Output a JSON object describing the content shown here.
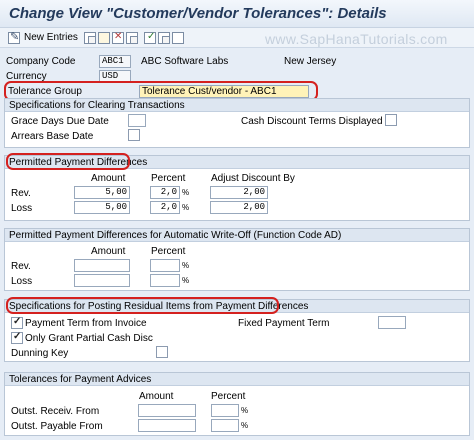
{
  "window": {
    "title": "Change View \"Customer/Vendor Tolerances\": Details"
  },
  "toolbar": {
    "new_entries": "New Entries",
    "icons": [
      "pen-icon",
      "save-icon",
      "copy-icon",
      "delete-icon",
      "select-all-icon",
      "deselect-icon",
      "copy-as-icon"
    ]
  },
  "watermark": "www.SapHanaTutorials.com",
  "header": {
    "company_code_label": "Company Code",
    "company_code_value": "ABC1",
    "company_name": "ABC Software Labs",
    "city": "New Jersey",
    "currency_label": "Currency",
    "currency_value": "USD",
    "tolerance_group_label": "Tolerance Group",
    "tolerance_group_value": "Tolerance Cust/vendor - ABC1"
  },
  "clearing": {
    "title": "Specifications for Clearing Transactions",
    "grace_days_label": "Grace Days Due Date",
    "grace_days_value": "",
    "cash_discount_label": "Cash Discount Terms Displayed",
    "arrears_label": "Arrears Base Date"
  },
  "permitted": {
    "title": "Permitted Payment Differences",
    "col_amount": "Amount",
    "col_percent": "Percent",
    "col_adjust": "Adjust Discount By",
    "rows": [
      {
        "label": "Rev.",
        "amount": "5,00",
        "percent": "2,0",
        "unit": "%",
        "adjust": "2,00"
      },
      {
        "label": "Loss",
        "amount": "5,00",
        "percent": "2,0",
        "unit": "%",
        "adjust": "2,00"
      }
    ]
  },
  "writeoff": {
    "title": "Permitted Payment Differences for Automatic Write-Off (Function Code AD)",
    "col_amount": "Amount",
    "col_percent": "Percent",
    "rows": [
      {
        "label": "Rev.",
        "amount": "",
        "percent": "",
        "unit": "%"
      },
      {
        "label": "Loss",
        "amount": "",
        "percent": "",
        "unit": "%"
      }
    ]
  },
  "residual": {
    "title": "Specifications for Posting Residual Items from Payment Differences",
    "payment_term_label": "Payment Term from Invoice",
    "payment_term_checked": true,
    "only_partial_label": "Only Grant Partial Cash Disc",
    "only_partial_checked": true,
    "dunning_key_label": "Dunning Key",
    "fixed_payment_term_label": "Fixed Payment Term",
    "fixed_payment_term_value": ""
  },
  "advices": {
    "title": "Tolerances for Payment Advices",
    "col_amount": "Amount",
    "col_percent": "Percent",
    "rows": [
      {
        "label": "Outst. Receiv. From",
        "amount": "",
        "percent": "",
        "unit": "%"
      },
      {
        "label": "Outst. Payable From",
        "amount": "",
        "percent": "",
        "unit": "%"
      }
    ]
  },
  "colors": {
    "highlight": "#d4211f",
    "field_yellow": "#fff3b8",
    "group_header": "#dde6f1"
  }
}
